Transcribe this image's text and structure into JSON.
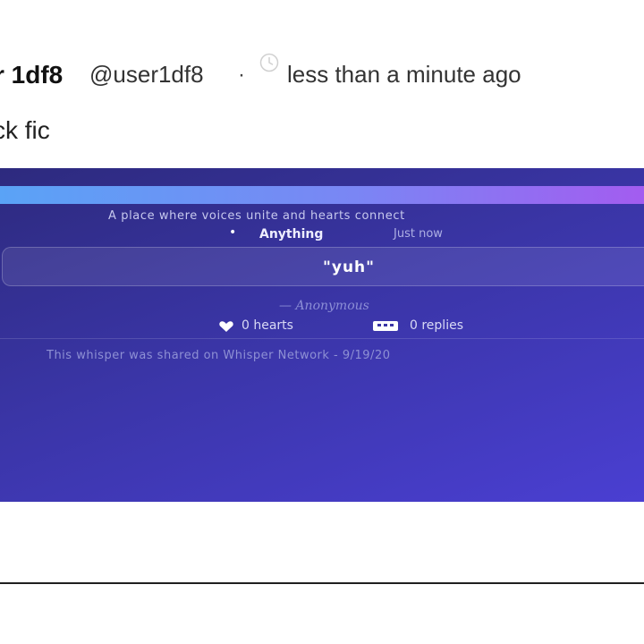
{
  "post": {
    "author_name": "r 1df8",
    "author_handle": "@user1df8",
    "separator": "·",
    "timestamp": "less than a minute ago",
    "text": "ck fic"
  },
  "embed": {
    "tagline": "A place where voices unite and hearts connect",
    "category": "Anything",
    "time": "Just now",
    "quote": "\"yuh\"",
    "signature": "— Anonymous",
    "hearts": "0 hearts",
    "replies": "0 replies",
    "footer": "This whisper was shared on Whisper Network - 9/19/20",
    "colors": {
      "bg_start": "#2d2a7e",
      "bg_end": "#4a3fd2",
      "bar_start": "#5aa3f6",
      "bar_end": "#a35cf0"
    }
  }
}
